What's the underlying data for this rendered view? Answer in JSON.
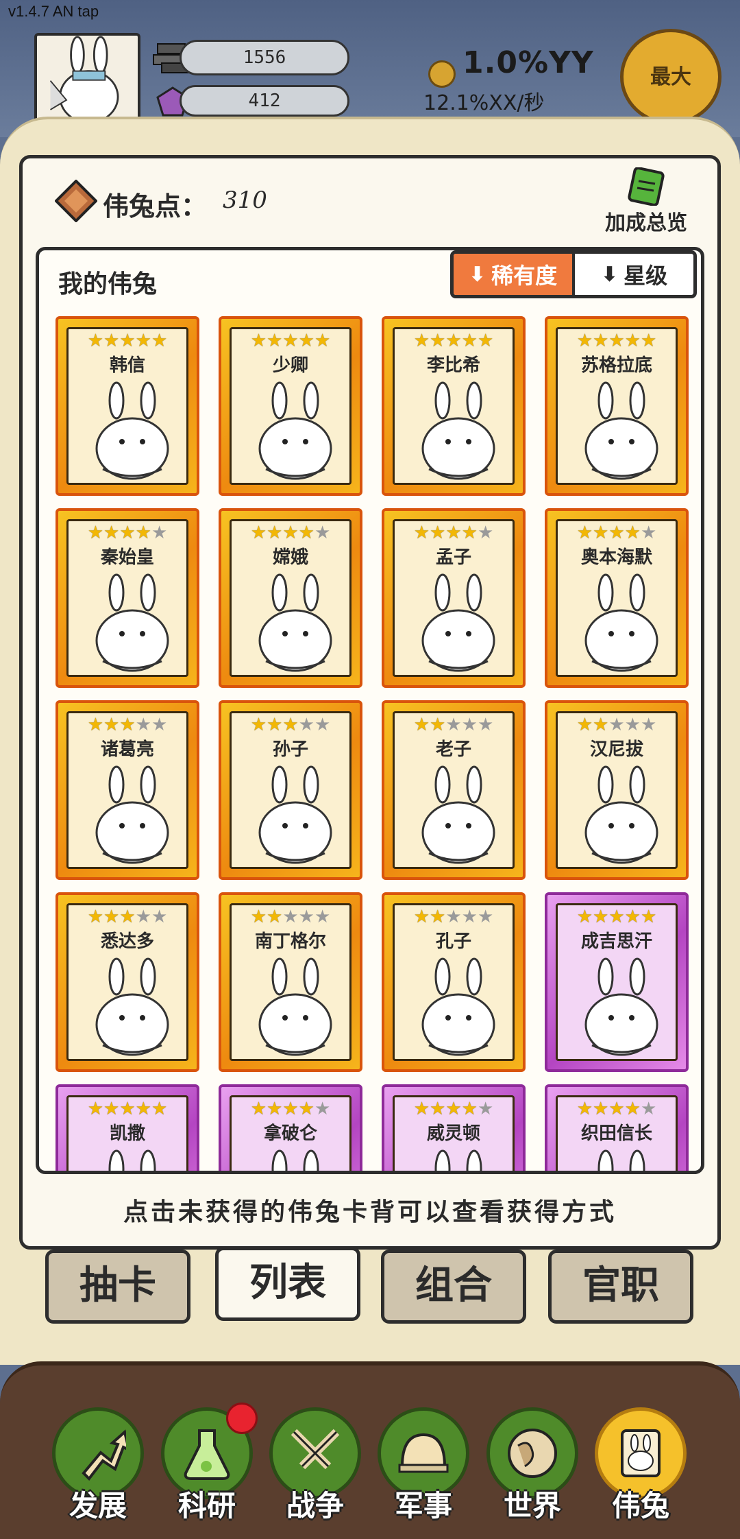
{
  "version": "v1.4.7 AN tap",
  "resources": {
    "stone": "1556",
    "gem": "412"
  },
  "income": {
    "rate": "1.0%YY",
    "per_sec": "12.1%XX/秒"
  },
  "max_button": "最大",
  "points": {
    "label": "伟兔点：",
    "value": "310"
  },
  "bonus_button": "加成总览",
  "section_title": "我的伟兔",
  "sort": {
    "rarity": "稀有度",
    "star": "星级"
  },
  "cards": [
    {
      "name": "韩信",
      "stars": 5,
      "rarity": "gold"
    },
    {
      "name": "少卿",
      "stars": 5,
      "rarity": "gold"
    },
    {
      "name": "李比希",
      "stars": 5,
      "rarity": "gold"
    },
    {
      "name": "苏格拉底",
      "stars": 5,
      "rarity": "gold"
    },
    {
      "name": "秦始皇",
      "stars": 4,
      "rarity": "gold"
    },
    {
      "name": "嫦娥",
      "stars": 4,
      "rarity": "gold"
    },
    {
      "name": "孟子",
      "stars": 4,
      "rarity": "gold"
    },
    {
      "name": "奥本海默",
      "stars": 4,
      "rarity": "gold"
    },
    {
      "name": "诸葛亮",
      "stars": 3,
      "rarity": "gold"
    },
    {
      "name": "孙子",
      "stars": 3,
      "rarity": "gold"
    },
    {
      "name": "老子",
      "stars": 2,
      "rarity": "gold"
    },
    {
      "name": "汉尼拔",
      "stars": 2,
      "rarity": "gold"
    },
    {
      "name": "悉达多",
      "stars": 3,
      "rarity": "gold"
    },
    {
      "name": "南丁格尔",
      "stars": 2,
      "rarity": "gold"
    },
    {
      "name": "孔子",
      "stars": 2,
      "rarity": "gold"
    },
    {
      "name": "成吉思汗",
      "stars": 5,
      "rarity": "purple"
    },
    {
      "name": "凯撒",
      "stars": 5,
      "rarity": "purple"
    },
    {
      "name": "拿破仑",
      "stars": 4,
      "rarity": "purple"
    },
    {
      "name": "威灵顿",
      "stars": 4,
      "rarity": "purple"
    },
    {
      "name": "织田信长",
      "stars": 4,
      "rarity": "purple"
    }
  ],
  "hint": "点击未获得的伟兔卡背可以查看获得方式",
  "tabs": [
    "抽卡",
    "列表",
    "组合",
    "官职"
  ],
  "active_tab": "列表",
  "nav": [
    {
      "label": "发展",
      "icon": "arrow-up-icon"
    },
    {
      "label": "科研",
      "icon": "flask-icon"
    },
    {
      "label": "战争",
      "icon": "crossed-swords-icon"
    },
    {
      "label": "军事",
      "icon": "helmet-icon"
    },
    {
      "label": "世界",
      "icon": "globe-icon"
    },
    {
      "label": "伟兔",
      "icon": "rabbit-card-icon"
    }
  ],
  "colors": {
    "accent": "#f07a3e",
    "gold_card": "#f7c322",
    "purple_card": "#b445c2",
    "nav_green": "#4f8b2a",
    "nav_active": "#f5c12b"
  }
}
